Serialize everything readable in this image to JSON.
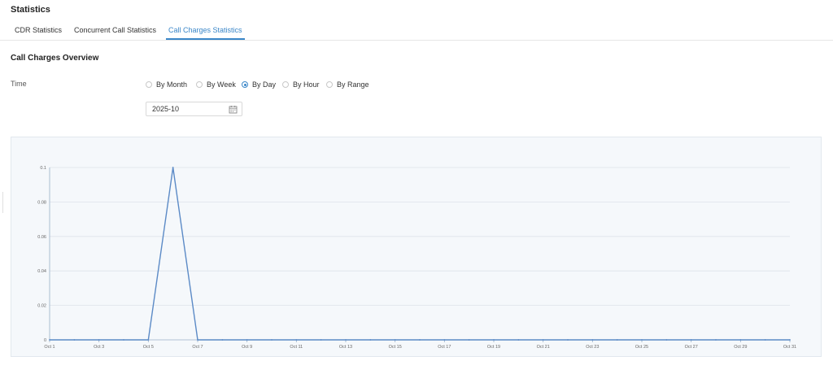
{
  "page": {
    "title": "Statistics"
  },
  "tabs": [
    {
      "label": "CDR Statistics",
      "active": false
    },
    {
      "label": "Concurrent Call Statistics",
      "active": false
    },
    {
      "label": "Call Charges Statistics",
      "active": true
    }
  ],
  "overview": {
    "title": "Call Charges Overview",
    "time_label": "Time",
    "options": [
      {
        "label": "By Month",
        "checked": false
      },
      {
        "label": "By Week",
        "checked": false
      },
      {
        "label": "By Day",
        "checked": true
      },
      {
        "label": "By Hour",
        "checked": false
      },
      {
        "label": "By Range",
        "checked": false
      }
    ],
    "date_value": "2025-10",
    "date_icon": "calendar-icon"
  },
  "colors": {
    "accent": "#3a86c8",
    "line": "#5b8ac6",
    "chart_bg": "#f5f8fb"
  },
  "chart_data": {
    "type": "line",
    "x": [
      "Oct 1",
      "Oct 2",
      "Oct 3",
      "Oct 4",
      "Oct 5",
      "Oct 6",
      "Oct 7",
      "Oct 8",
      "Oct 9",
      "Oct 10",
      "Oct 11",
      "Oct 12",
      "Oct 13",
      "Oct 14",
      "Oct 15",
      "Oct 16",
      "Oct 17",
      "Oct 18",
      "Oct 19",
      "Oct 20",
      "Oct 21",
      "Oct 22",
      "Oct 23",
      "Oct 24",
      "Oct 25",
      "Oct 26",
      "Oct 27",
      "Oct 28",
      "Oct 29",
      "Oct 30",
      "Oct 31"
    ],
    "x_tick_labels": [
      "Oct 1",
      "Oct 3",
      "Oct 5",
      "Oct 7",
      "Oct 9",
      "Oct 11",
      "Oct 13",
      "Oct 15",
      "Oct 17",
      "Oct 19",
      "Oct 21",
      "Oct 23",
      "Oct 25",
      "Oct 27",
      "Oct 29",
      "Oct 31"
    ],
    "series": [
      {
        "values": [
          0,
          0,
          0,
          0,
          0,
          0.1,
          0,
          0,
          0,
          0,
          0,
          0,
          0,
          0,
          0,
          0,
          0,
          0,
          0,
          0,
          0,
          0,
          0,
          0,
          0,
          0,
          0,
          0,
          0,
          0,
          0
        ]
      }
    ],
    "y_ticks": [
      "0",
      "0.02",
      "0.04",
      "0.06",
      "0.08",
      "0.1"
    ],
    "ylim": [
      0,
      0.1
    ],
    "grid": true,
    "title": "",
    "xlabel": "",
    "ylabel": ""
  }
}
